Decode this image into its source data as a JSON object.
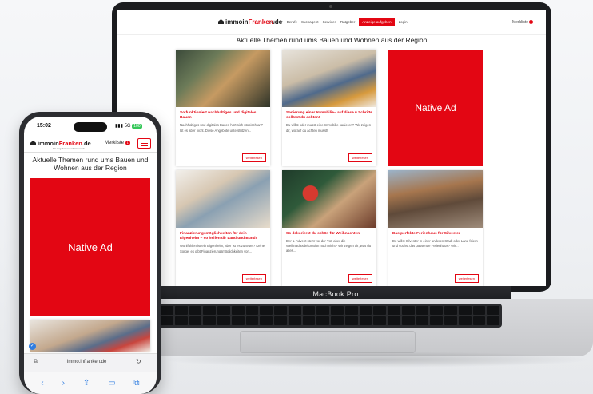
{
  "site": {
    "logo_prefix": "immo",
    "logo_mid": "in",
    "logo_brand": "Franken",
    "logo_suffix": ".de",
    "merkliste_label": "Merkliste",
    "merkliste_count": "1",
    "section_title": "Aktuelle Themen rund ums Bauen und Wohnen aus der Region",
    "native_ad_label": "Native Ad",
    "nav": [
      "Anbieter",
      "Berufe",
      "Suchagent",
      "Services",
      "Ratgeber",
      "Anzeige aufgeben",
      "Login"
    ]
  },
  "laptop": {
    "brand": "MacBook Pro",
    "cards": [
      {
        "title": "So funktioniert nachhaltiges und digitales Bauen",
        "text": "Nachhaltiges und digitales Bauen hört sich utopisch an? Ist es aber nicht. Diese Angebote unterstützen...",
        "more": "weiterlesen"
      },
      {
        "title": "Sanierung einer Immobilie– auf diese 6 Schritte solltest du achten!",
        "text": "Du willst oder musst eine Immobilie sanieren? Wir zeigen dir, worauf du achten musst!",
        "more": "weiterlesen"
      },
      {
        "title": "Finanzierungsmöglichkeiten für dein Eigenheim – so helfen dir Land und Bund!",
        "text": "Wohlfühlen ist ein Eigenheim, aber ist es zu teuer? Keine Sorge, es gibt Finanzierungsmöglichkeiten von...",
        "more": "weiterlesen"
      },
      {
        "title": "So dekorierst du schön für Weihnachten",
        "text": "Der 1. Advent steht vor der Tür, aber die Weihnachtsdekoration noch nicht? Wir zeigen dir, was du alles...",
        "more": "weiterlesen"
      },
      {
        "title": "Das perfekte Ferienhaus für Silvester",
        "text": "Du willst Silvester in einer anderen Stadt oder Land feiern und suchst das passende Ferienhaus? Wir...",
        "more": "weiterlesen"
      }
    ]
  },
  "phone": {
    "time": "15:02",
    "signal": "5G",
    "battery": "100",
    "url": "immo.infranken.de",
    "tagline": "Ein Angebot von inFranken.de"
  },
  "colors": {
    "brand_red": "#e30613",
    "link_blue": "#2f7de1"
  }
}
